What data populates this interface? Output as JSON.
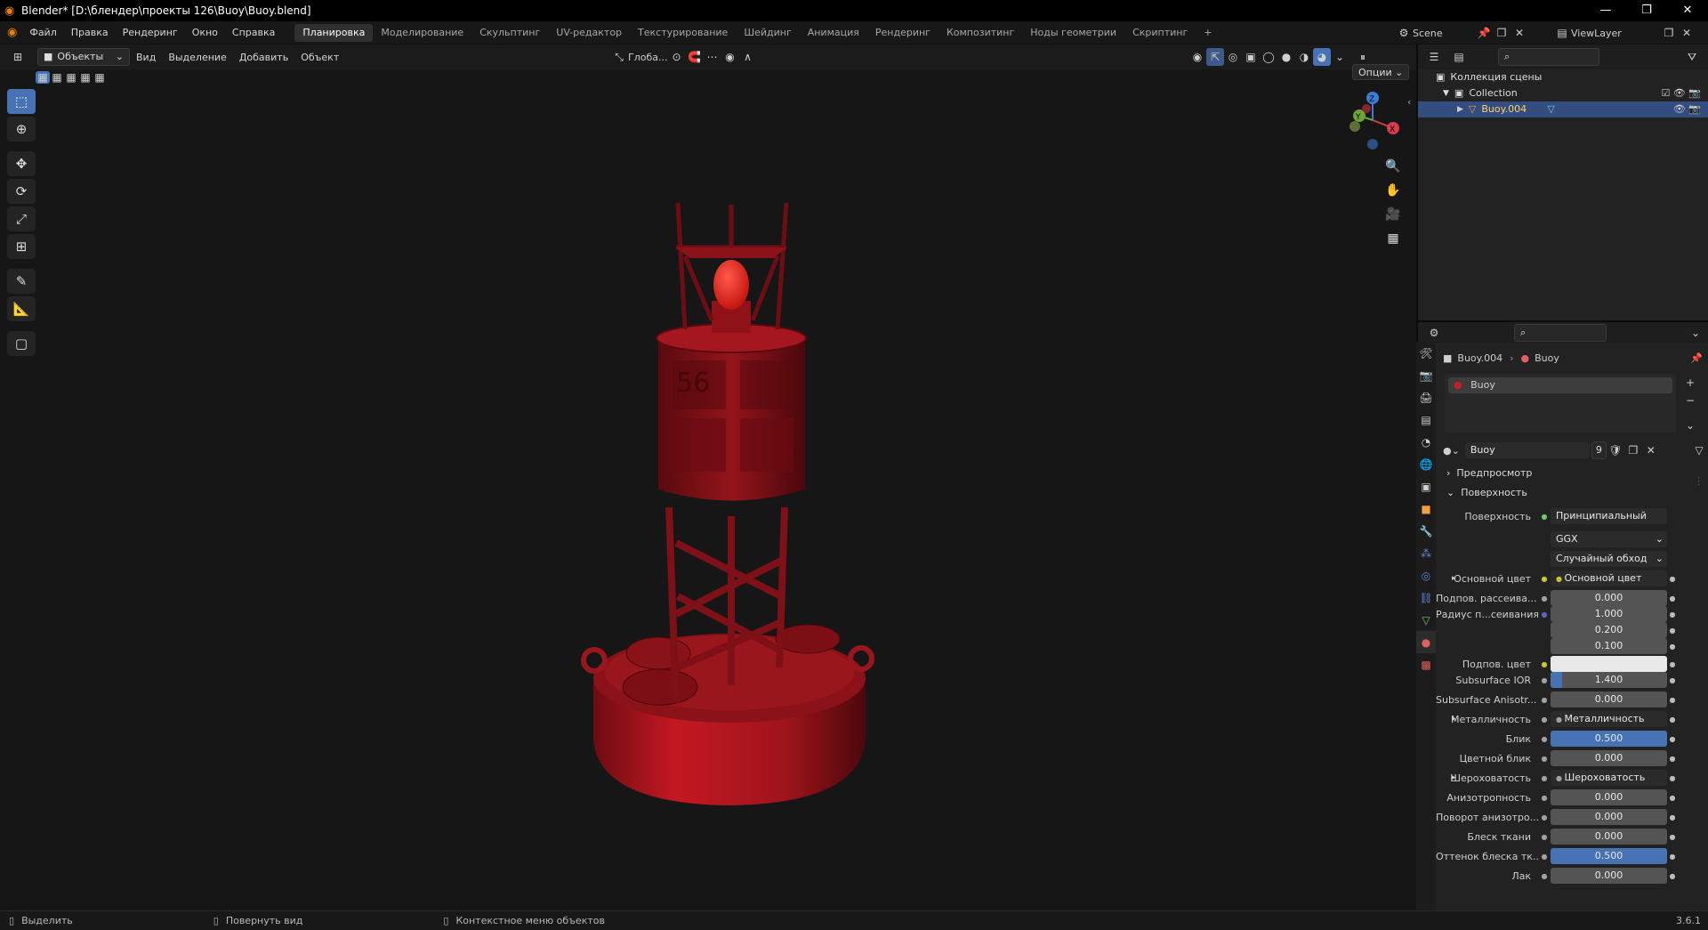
{
  "window": {
    "title": "Blender* [D:\\блендер\\проекты 126\\Buoy\\Buoy.blend]",
    "controls": [
      "—",
      "❐",
      "✕"
    ]
  },
  "menu": [
    "Файл",
    "Правка",
    "Рендеринг",
    "Окно",
    "Справка"
  ],
  "workspaces": [
    {
      "label": "Планировка",
      "active": true
    },
    {
      "label": "Моделирование"
    },
    {
      "label": "Скульптинг"
    },
    {
      "label": "UV-редактор"
    },
    {
      "label": "Текстурирование"
    },
    {
      "label": "Шейдинг"
    },
    {
      "label": "Анимация"
    },
    {
      "label": "Рендеринг"
    },
    {
      "label": "Композитинг"
    },
    {
      "label": "Ноды геометрии"
    },
    {
      "label": "Скриптинг"
    }
  ],
  "add_workspace": "+",
  "scene": {
    "label": "Scene",
    "viewlayer": "ViewLayer"
  },
  "viewport_header": {
    "mode": "Объекты",
    "items": [
      "Вид",
      "Выделение",
      "Добавить",
      "Объект"
    ],
    "orientation": "Глоба...",
    "options": "Опции"
  },
  "outliner": {
    "root": "Коллекция сцены",
    "collection": "Collection",
    "object": "Buoy.004"
  },
  "properties": {
    "breadcrumb_object": "Buoy.004",
    "breadcrumb_material": "Buoy",
    "slot_name": "Buoy",
    "material_name": "Buoy",
    "user_count": "9",
    "preview": "Предпросмотр",
    "surface_section": "Поверхность",
    "surface_label": "Поверхность",
    "surface_value": "Принципиальный BSDF",
    "distribution": "GGX",
    "subsurface_method": "Случайный обход",
    "rows": [
      {
        "label": "Основной цвет",
        "value": "Основной цвет",
        "type": "link",
        "dot": "#c7c729",
        "expander": true
      },
      {
        "label": "Подпов. рассеива...",
        "value": "0.000",
        "fill": 0,
        "dot": "#a1a1a1"
      },
      {
        "label": "Радиус п...сеивания",
        "value": "1.000",
        "fill": 0,
        "dot": "#6363c7"
      },
      {
        "label": "",
        "value": "0.200",
        "fill": 0,
        "dot": ""
      },
      {
        "label": "",
        "value": "0.100",
        "fill": 0,
        "dot": ""
      },
      {
        "label": "Подпов. цвет",
        "value": "",
        "type": "color",
        "color": "#e8e8e8",
        "dot": "#c7c729"
      },
      {
        "label": "Subsurface IOR",
        "value": "1.400",
        "fill": 0.1,
        "dot": "#a1a1a1"
      },
      {
        "label": "Subsurface Anisotr...",
        "value": "0.000",
        "fill": 0,
        "dot": "#a1a1a1"
      },
      {
        "label": "Металличность",
        "value": "Металличность",
        "type": "link",
        "dot": "#a1a1a1",
        "expander": true
      },
      {
        "label": "Блик",
        "value": "0.500",
        "fill": 1,
        "dot": "#a1a1a1"
      },
      {
        "label": "Цветной блик",
        "value": "0.000",
        "fill": 0,
        "dot": "#a1a1a1"
      },
      {
        "label": "Шероховатость",
        "value": "Шероховатость",
        "type": "link",
        "dot": "#a1a1a1",
        "expander": true
      },
      {
        "label": "Анизотропность",
        "value": "0.000",
        "fill": 0,
        "dot": "#a1a1a1"
      },
      {
        "label": "Поворот анизотро...",
        "value": "0.000",
        "fill": 0,
        "dot": "#a1a1a1"
      },
      {
        "label": "Блеск ткани",
        "value": "0.000",
        "fill": 0,
        "dot": "#a1a1a1"
      },
      {
        "label": "Оттенок блеска тк...",
        "value": "0.500",
        "fill": 1,
        "dot": "#a1a1a1"
      },
      {
        "label": "Лак",
        "value": "0.000",
        "fill": 0,
        "dot": "#a1a1a1"
      }
    ]
  },
  "statusbar": {
    "left": "Выделить",
    "middle": "Повернуть вид",
    "right": "Контекстное меню объектов",
    "version": "3.6.1"
  },
  "model": {
    "label_text": "56"
  },
  "colors": {
    "accent": "#4772b3",
    "selection": "#334d80",
    "buoy_red": "#b0141c"
  }
}
